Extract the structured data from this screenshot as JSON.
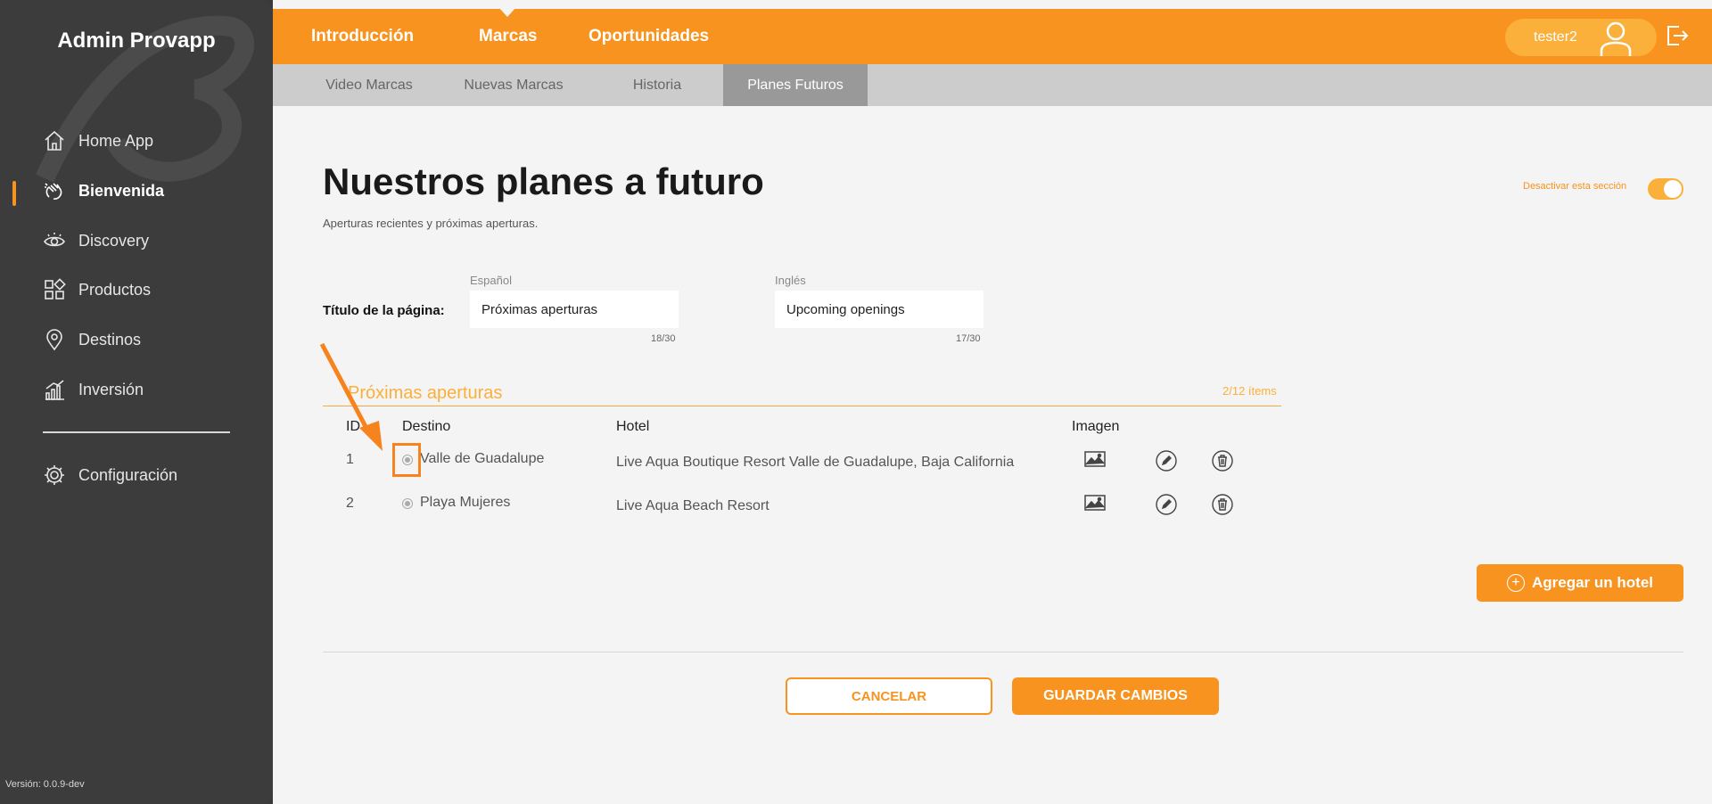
{
  "app": {
    "brand": "Admin Provapp",
    "version": "Versión: 0.0.9-dev"
  },
  "sidebar": {
    "items": [
      {
        "label": "Home App",
        "icon": "home-icon"
      },
      {
        "label": "Bienvenida",
        "icon": "waving-hand-icon",
        "active": true
      },
      {
        "label": "Discovery",
        "icon": "eye-icon"
      },
      {
        "label": "Productos",
        "icon": "grid-icon"
      },
      {
        "label": "Destinos",
        "icon": "location-pin-icon"
      },
      {
        "label": "Inversión",
        "icon": "chart-bars-icon"
      }
    ],
    "config": {
      "label": "Configuración",
      "icon": "gear-icon"
    }
  },
  "header": {
    "tabs": [
      {
        "label": "Introducción"
      },
      {
        "label": "Marcas",
        "active": true
      },
      {
        "label": "Oportunidades"
      }
    ],
    "user": "tester2"
  },
  "subnav": {
    "tabs": [
      {
        "label": "Video Marcas"
      },
      {
        "label": "Nuevas Marcas"
      },
      {
        "label": "Historia"
      },
      {
        "label": "Planes Futuros",
        "active": true
      }
    ]
  },
  "page": {
    "title": "Nuestros planes a futuro",
    "subtitle": "Aperturas recientes y próximas aperturas.",
    "toggle_label": "Desactivar esta sección",
    "toggle_on": true
  },
  "title_field": {
    "label": "Título de la página:",
    "es": {
      "lang": "Español",
      "value": "Próximas aperturas",
      "counter": "18/30"
    },
    "en": {
      "lang": "Inglés",
      "value": "Upcoming openings",
      "counter": "17/30"
    }
  },
  "section": {
    "title": "Próximas aperturas",
    "count": "2/12 ítems",
    "columns": [
      "ID",
      "Destino",
      "Hotel",
      "Imagen"
    ],
    "rows": [
      {
        "id": "1",
        "destino": "Valle de Guadalupe",
        "hotel": "Live Aqua Boutique Resort Valle de Guadalupe, Baja California"
      },
      {
        "id": "2",
        "destino": "Playa Mujeres",
        "hotel": "Live Aqua Beach Resort"
      }
    ]
  },
  "actions": {
    "add_hotel": "Agregar un hotel",
    "cancel": "CANCELAR",
    "save": "GUARDAR CAMBIOS"
  },
  "colors": {
    "accent": "#f7931e",
    "accent_light": "#fbb03b",
    "sidebar": "#3c3c3c"
  }
}
